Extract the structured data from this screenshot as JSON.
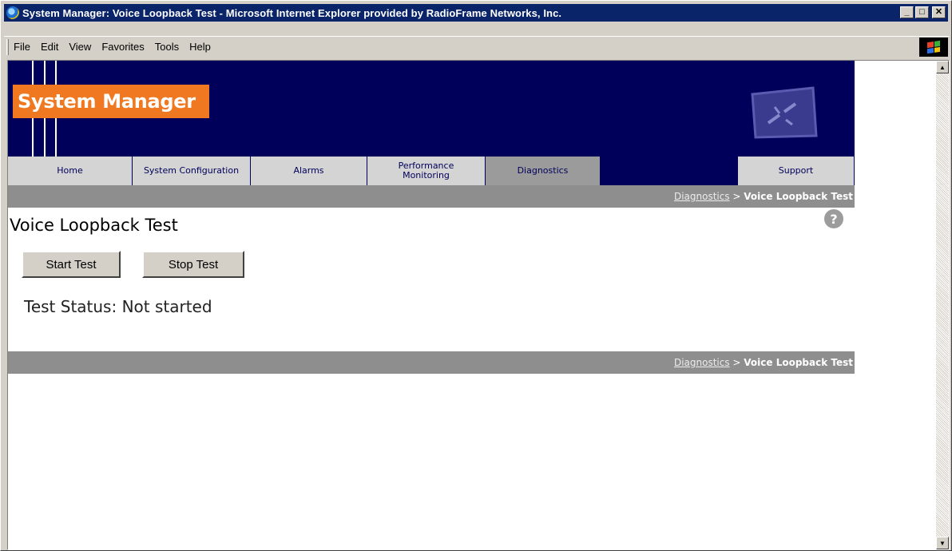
{
  "window": {
    "title": "System Manager: Voice Loopback Test - Microsoft Internet Explorer provided by RadioFrame Networks, Inc.",
    "controls": {
      "minimize": "_",
      "maximize": "□",
      "close": "✕"
    }
  },
  "menu": {
    "items": [
      "File",
      "Edit",
      "View",
      "Favorites",
      "Tools",
      "Help"
    ]
  },
  "banner": {
    "logo_text": "System Manager"
  },
  "nav": {
    "tabs": [
      {
        "label": "Home"
      },
      {
        "label": "System Configuration"
      },
      {
        "label": "Alarms"
      },
      {
        "label": "Performance Monitoring"
      },
      {
        "label": "Diagnostics"
      },
      {
        "label": "Support"
      }
    ],
    "active": "Diagnostics"
  },
  "breadcrumb": {
    "parent": "Diagnostics",
    "separator": " > ",
    "current": "Voice Loopback Test"
  },
  "main": {
    "title": "Voice Loopback Test",
    "help_glyph": "?",
    "start_button": "Start Test",
    "stop_button": "Stop Test",
    "status_text": "Test Status: Not started"
  },
  "colors": {
    "banner_navy": "#00005a",
    "logo_orange": "#f07820",
    "crumb_gray": "#8e8e8e",
    "title_bar": "#0a246a"
  }
}
